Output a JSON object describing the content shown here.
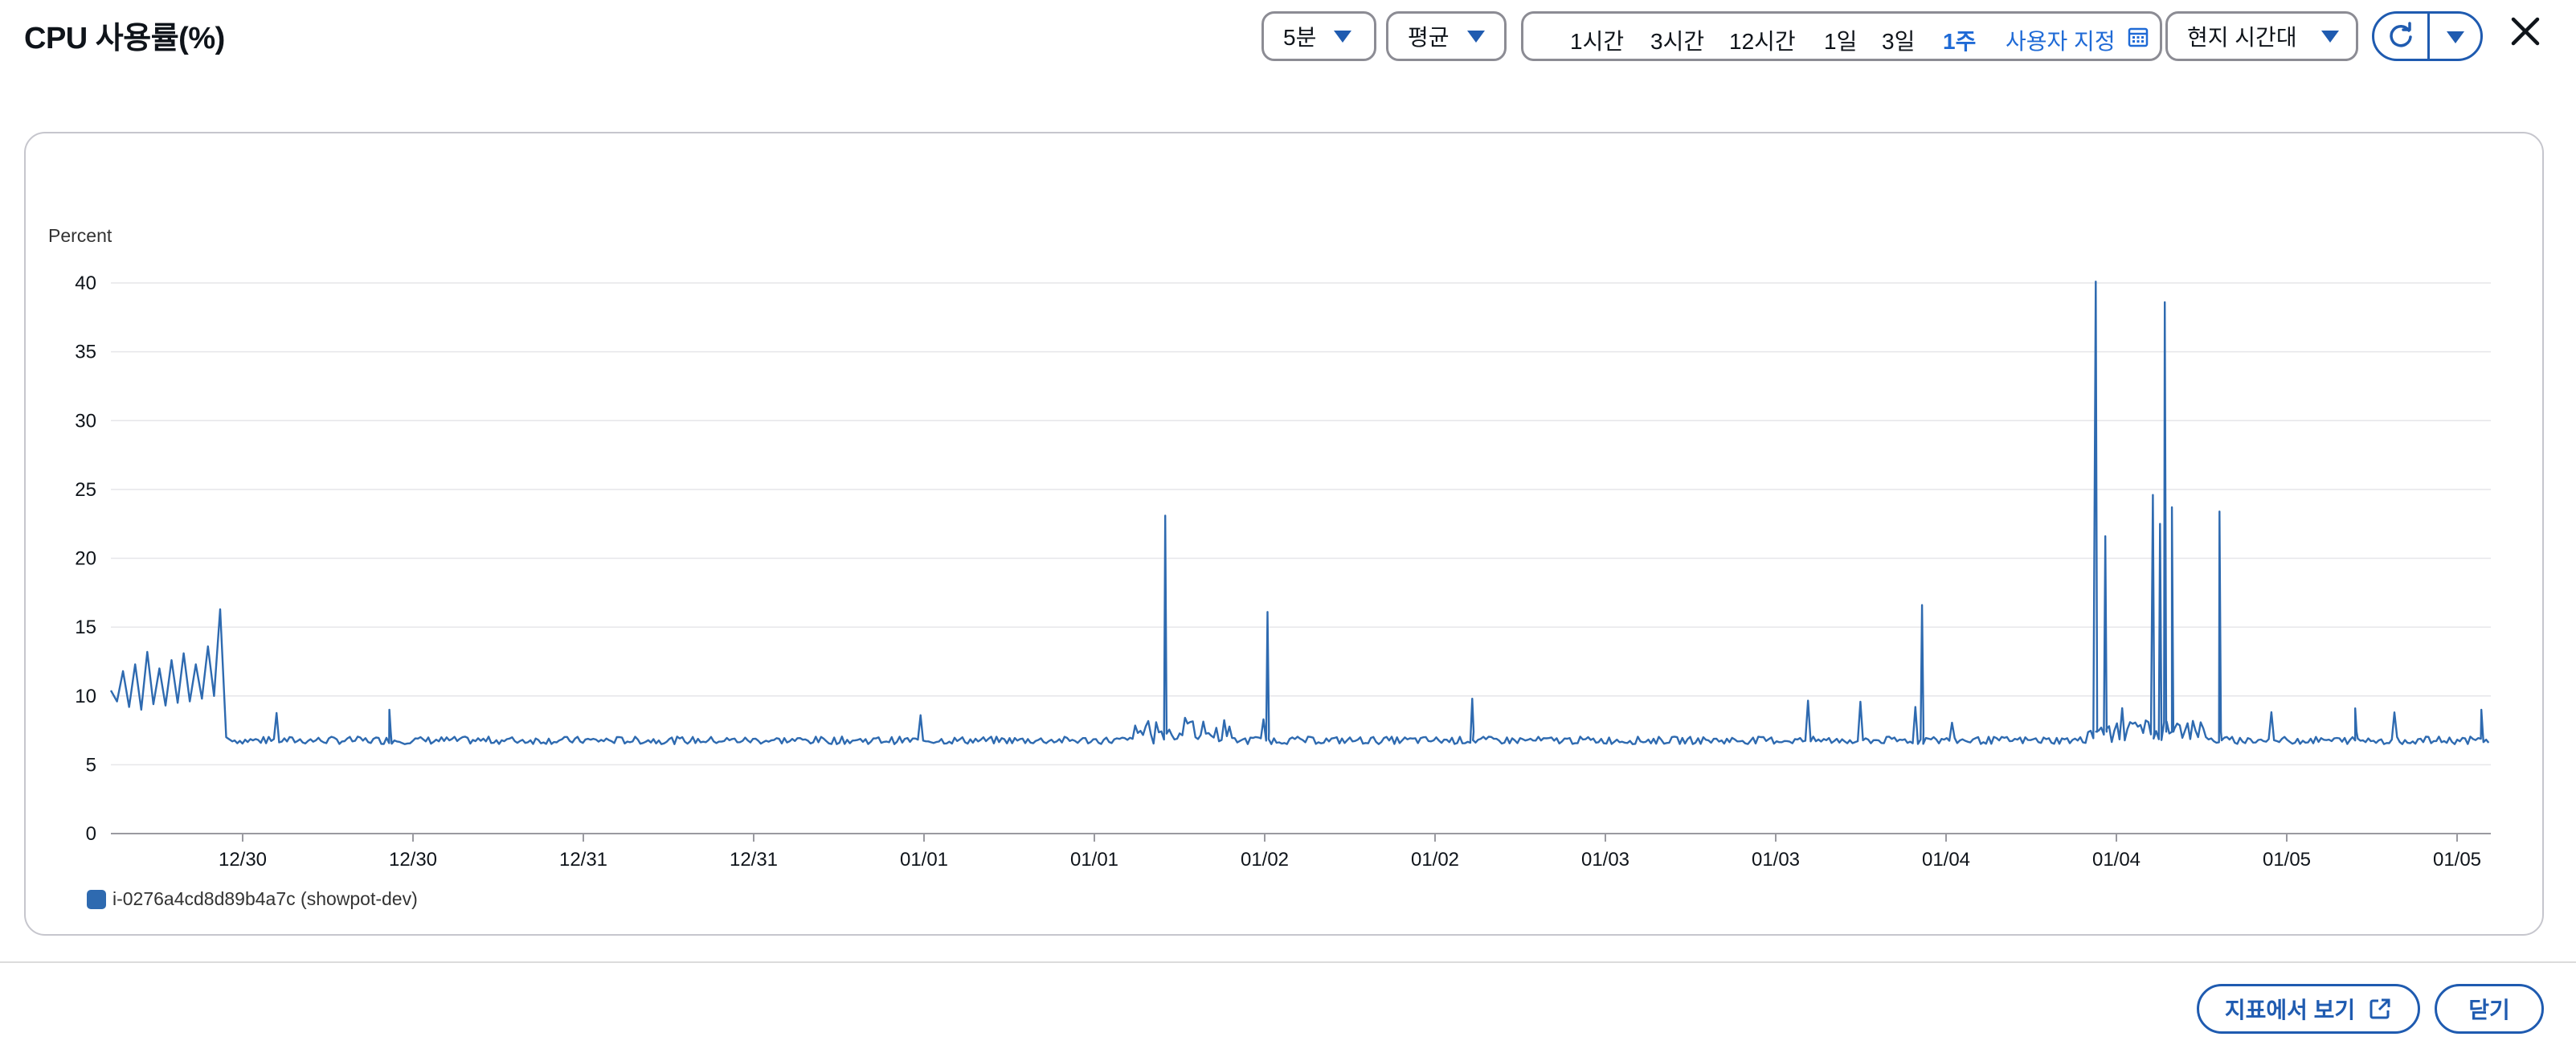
{
  "header": {
    "title": "CPU 사용률(%)",
    "period": "5분",
    "statistic": "평균",
    "timezone": "현지 시간대",
    "ranges": [
      "1시간",
      "3시간",
      "12시간",
      "1일",
      "3일",
      "1주"
    ],
    "active_range": "1주",
    "custom_label": "사용자 지정"
  },
  "footer": {
    "view_in_metrics": "지표에서 보기",
    "close": "닫기"
  },
  "colors": {
    "series": "#2e6ab0",
    "accent": "#1f6ad6",
    "border": "#8c8c94"
  },
  "chart_data": {
    "type": "line",
    "title": "",
    "ylabel": "Percent",
    "ylim": [
      0,
      40
    ],
    "yticks": [
      0,
      5,
      10,
      15,
      20,
      25,
      30,
      35,
      40
    ],
    "x_tick_labels": [
      "12/30",
      "12/30",
      "12/31",
      "12/31",
      "01/01",
      "01/01",
      "01/02",
      "01/02",
      "01/03",
      "01/03",
      "01/04",
      "01/04",
      "01/05",
      "01/05"
    ],
    "grid": true,
    "legend_position": "bottom-left",
    "series": [
      {
        "name": "i-0276a4cd8d89b4a7c (showpot-dev)",
        "baseline": 6.8,
        "points": [
          [
            0.0,
            10.4
          ],
          [
            0.01,
            9.6
          ],
          [
            0.02,
            11.8
          ],
          [
            0.03,
            9.2
          ],
          [
            0.04,
            12.3
          ],
          [
            0.05,
            9.0
          ],
          [
            0.06,
            13.2
          ],
          [
            0.07,
            9.4
          ],
          [
            0.08,
            12.0
          ],
          [
            0.09,
            9.3
          ],
          [
            0.1,
            12.6
          ],
          [
            0.11,
            9.5
          ],
          [
            0.12,
            13.1
          ],
          [
            0.13,
            9.6
          ],
          [
            0.14,
            12.3
          ],
          [
            0.15,
            9.8
          ],
          [
            0.16,
            13.6
          ],
          [
            0.17,
            10.0
          ],
          [
            0.18,
            16.3
          ],
          [
            0.19,
            7.0
          ],
          [
            0.2,
            6.7
          ],
          [
            0.21,
            6.8
          ],
          [
            0.22,
            6.6
          ],
          [
            0.235,
            6.9
          ],
          [
            0.25,
            6.6
          ],
          [
            0.26,
            6.7
          ],
          [
            0.27,
            6.5
          ],
          [
            0.28,
            6.8
          ],
          [
            0.295,
            6.6
          ],
          [
            0.305,
            6.9
          ],
          [
            0.315,
            6.7
          ],
          [
            0.325,
            9.0
          ],
          [
            0.33,
            6.7
          ],
          [
            0.34,
            6.6
          ],
          [
            0.355,
            6.9
          ],
          [
            0.37,
            6.6
          ],
          [
            0.385,
            6.8
          ],
          [
            0.4,
            6.5
          ],
          [
            0.415,
            6.7
          ],
          [
            0.43,
            6.9
          ],
          [
            0.445,
            6.6
          ],
          [
            0.46,
            6.8
          ],
          [
            0.475,
            6.7
          ],
          [
            0.49,
            6.6
          ],
          [
            0.505,
            6.9
          ],
          [
            0.52,
            6.6
          ],
          [
            0.535,
            6.8
          ],
          [
            0.55,
            6.7
          ],
          [
            0.565,
            6.6
          ],
          [
            0.58,
            6.9
          ],
          [
            0.595,
            6.5
          ],
          [
            0.61,
            6.7
          ],
          [
            0.625,
            6.8
          ],
          [
            0.64,
            6.6
          ],
          [
            0.655,
            6.7
          ],
          [
            0.67,
            6.9
          ],
          [
            0.685,
            6.6
          ],
          [
            0.7,
            6.8
          ],
          [
            0.715,
            6.6
          ],
          [
            0.73,
            6.9
          ],
          [
            0.745,
            6.7
          ],
          [
            0.76,
            6.6
          ],
          [
            0.775,
            6.8
          ],
          [
            0.79,
            6.7
          ],
          [
            0.805,
            6.6
          ],
          [
            0.82,
            6.9
          ],
          [
            0.835,
            6.7
          ],
          [
            0.85,
            6.6
          ],
          [
            0.865,
            6.8
          ],
          [
            0.875,
            7.4
          ],
          [
            0.88,
            6.7
          ],
          [
            0.885,
            7.8
          ],
          [
            0.89,
            6.6
          ],
          [
            0.895,
            8.6
          ],
          [
            0.9,
            7.0
          ],
          [
            0.905,
            8.5
          ],
          [
            0.91,
            6.8
          ],
          [
            1.0,
            6.6
          ]
        ],
        "spikes": [
          {
            "x": "12/30",
            "y": 16.3
          },
          {
            "x": "12/30",
            "y": 9.0
          },
          {
            "x": "01/01",
            "y": 23.1
          },
          {
            "x": "01/02",
            "y": 16.1
          },
          {
            "x": "01/02",
            "y": 9.8
          },
          {
            "x": "01/04",
            "y": 16.6
          },
          {
            "x": "01/04",
            "y": 40.1
          },
          {
            "x": "01/04",
            "y": 21.6
          },
          {
            "x": "01/04",
            "y": 24.6
          },
          {
            "x": "01/04",
            "y": 38.6
          },
          {
            "x": "01/04",
            "y": 23.7
          },
          {
            "x": "01/04",
            "y": 23.4
          },
          {
            "x": "01/05",
            "y": 9.1
          },
          {
            "x": "01/05",
            "y": 9.0
          }
        ]
      }
    ]
  }
}
